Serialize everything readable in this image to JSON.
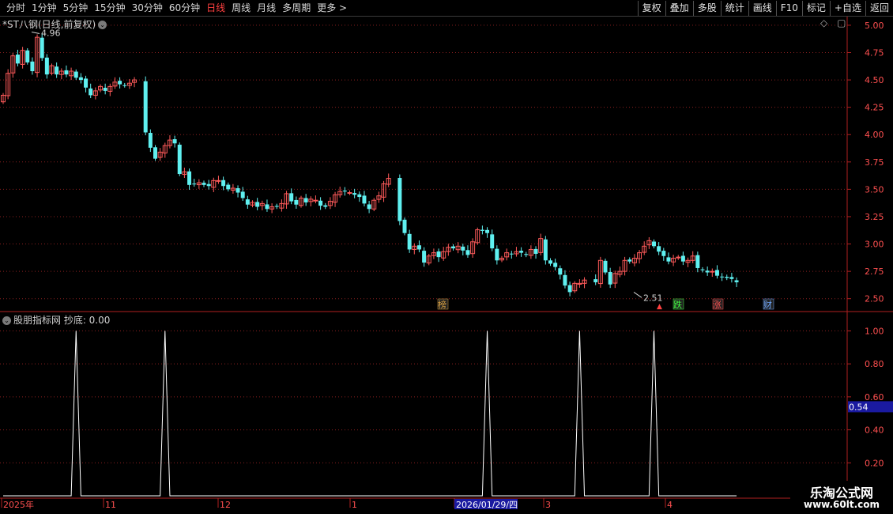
{
  "toolbar": {
    "periods": [
      "分时",
      "1分钟",
      "5分钟",
      "15分钟",
      "30分钟",
      "60分钟",
      "日线",
      "周线",
      "月线",
      "多周期",
      "更多 >"
    ],
    "active_period": "日线",
    "right_buttons": [
      "复权",
      "叠加",
      "多股",
      "统计",
      "画线",
      "F10",
      "标记",
      "+自选",
      "返回"
    ]
  },
  "main_panel": {
    "title": "*ST八钢(日线,前复权)",
    "high_label": "4.96",
    "low_label": "2.51",
    "price_ticks": [
      "5.00",
      "4.75",
      "4.50",
      "4.25",
      "4.00",
      "3.75",
      "3.50",
      "3.25",
      "3.00",
      "2.75",
      "2.50"
    ],
    "markers": [
      {
        "text": "榜",
        "color": "#d9a040"
      },
      {
        "text": "跌",
        "color": "#40ff40"
      },
      {
        "text": "涨",
        "color": "#ff5050"
      },
      {
        "text": "财",
        "color": "#6fa8ff"
      }
    ]
  },
  "indicator_panel": {
    "title": "股朋指标网 抄底: 0.00",
    "ticks": [
      "1.00",
      "0.80",
      "0.60",
      "0.40",
      "0.20"
    ],
    "current_value": "0.54"
  },
  "time_axis": {
    "labels": [
      "2025年",
      "11",
      "12",
      "1",
      "2026/01/29/四",
      "3",
      "4"
    ]
  },
  "watermark": {
    "title": "乐淘公式网",
    "url": "www.60lt.com"
  },
  "colors": {
    "up": "#ff5a5a",
    "down": "#5ff0f0",
    "grid": "#8a1f1f",
    "axis": "#b02020"
  },
  "chart_data": {
    "type": "candlestick",
    "title": "*ST八钢(日线,前复权)",
    "ylim": [
      2.44,
      5.05
    ],
    "closes": [
      4.36,
      4.56,
      4.72,
      4.65,
      4.77,
      4.66,
      4.58,
      4.89,
      4.7,
      4.55,
      4.63,
      4.55,
      4.58,
      4.55,
      4.58,
      4.52,
      4.5,
      4.43,
      4.36,
      4.4,
      4.44,
      4.4,
      4.44,
      4.48,
      4.46,
      4.45,
      4.47,
      4.5,
      4.02,
      3.88,
      3.78,
      3.84,
      3.9,
      3.95,
      3.92,
      3.64,
      3.66,
      3.54,
      3.55,
      3.56,
      3.54,
      3.53,
      3.58,
      3.58,
      3.53,
      3.5,
      3.51,
      3.47,
      3.42,
      3.36,
      3.38,
      3.34,
      3.37,
      3.32,
      3.34,
      3.34,
      3.37,
      3.46,
      3.39,
      3.36,
      3.42,
      3.38,
      3.41,
      3.4,
      3.35,
      3.34,
      3.39,
      3.45,
      3.48,
      3.48,
      3.47,
      3.45,
      3.43,
      3.37,
      3.32,
      3.4,
      3.44,
      3.55,
      3.6,
      3.21,
      3.1,
      2.95,
      2.98,
      2.95,
      2.83,
      2.89,
      2.92,
      2.88,
      2.93,
      2.97,
      2.96,
      2.98,
      2.94,
      2.9,
      3.02,
      3.13,
      3.12,
      3.1,
      2.96,
      2.85,
      2.87,
      2.92,
      2.91,
      2.93,
      2.92,
      2.9,
      2.95,
      2.91,
      3.05,
      2.85,
      2.82,
      2.79,
      2.72,
      2.62,
      2.56,
      2.64,
      2.64,
      2.67,
      2.65,
      2.85,
      2.74,
      2.63,
      2.73,
      2.75,
      2.85,
      2.84,
      2.87,
      2.92,
      2.98,
      3.03,
      2.98,
      2.93,
      2.89,
      2.84,
      2.87,
      2.88,
      2.84,
      2.85,
      2.89,
      2.78,
      2.76,
      2.74,
      2.75,
      2.71,
      2.7,
      2.69,
      2.68,
      2.65
    ],
    "indicator_values": [
      0,
      0,
      0,
      0,
      0,
      0,
      0,
      0,
      0,
      0,
      0,
      0,
      0,
      0,
      0,
      0,
      0,
      0,
      0,
      0,
      0,
      0,
      0,
      0,
      0,
      0,
      0,
      0,
      0,
      0,
      0,
      0,
      0,
      0,
      0,
      0,
      0,
      0,
      0,
      0,
      0,
      0,
      0,
      0,
      0,
      0,
      0,
      0,
      0,
      0,
      0,
      0,
      0,
      0,
      0,
      0,
      0,
      0,
      0,
      0,
      0,
      0,
      0,
      0,
      0,
      0,
      0,
      0,
      0,
      0,
      0,
      0,
      0,
      0,
      0,
      0,
      0,
      0,
      0,
      0,
      0,
      0,
      0,
      0,
      0,
      0,
      0,
      0,
      0,
      0,
      0,
      0,
      0,
      0,
      0,
      0,
      0,
      0,
      0,
      0,
      0,
      0,
      0,
      0,
      0,
      0,
      0,
      0,
      0,
      0,
      0,
      0,
      0,
      0,
      0,
      0,
      0,
      0,
      0,
      0,
      0,
      0,
      0,
      0,
      0,
      0,
      0,
      0,
      0,
      0,
      0,
      0,
      0,
      0,
      0,
      0,
      0,
      0,
      0,
      0,
      0,
      0,
      0,
      0,
      0,
      0,
      0,
      0,
      0,
      0,
      0,
      0,
      0,
      0,
      0,
      0,
      0,
      0,
      0,
      0,
      0,
      0,
      0,
      0,
      0,
      0,
      0,
      0,
      0,
      0,
      0,
      0
    ],
    "indicator_spikes": [
      1,
      1,
      1,
      1,
      1,
      1,
      1
    ],
    "indicator_ylim": [
      0,
      1.05
    ]
  }
}
